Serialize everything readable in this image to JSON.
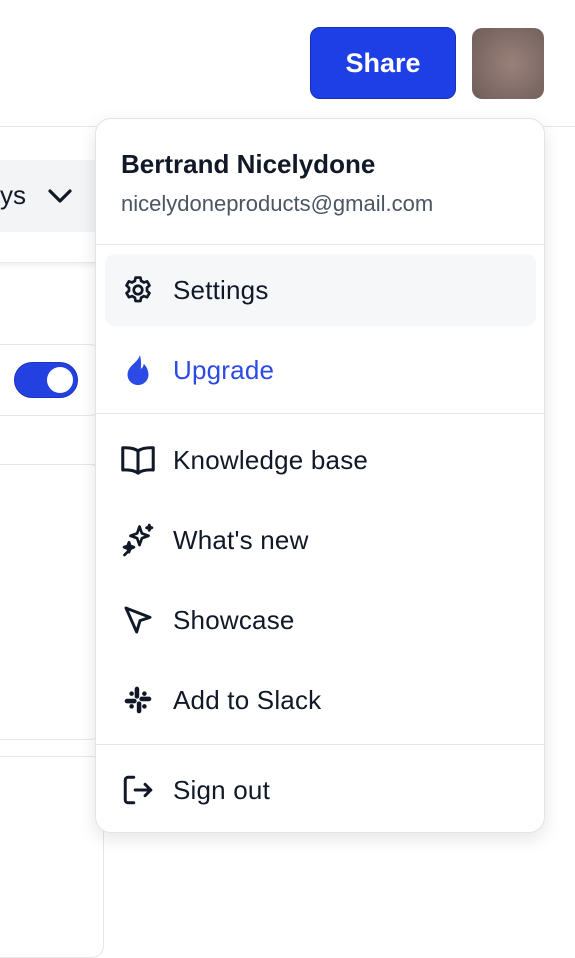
{
  "header": {
    "share_label": "Share",
    "avatar_color": "#86716b"
  },
  "background": {
    "select_text": "ys",
    "toggle_on": true
  },
  "menu": {
    "user_name": "Bertrand Nicelydone",
    "user_email": "nicelydoneproducts@gmail.com",
    "items": [
      {
        "label": "Settings",
        "icon": "gear-icon"
      },
      {
        "label": "Upgrade",
        "icon": "flame-icon"
      },
      {
        "label": "Knowledge base",
        "icon": "book-open-icon"
      },
      {
        "label": "What's new",
        "icon": "sparkles-icon"
      },
      {
        "label": "Showcase",
        "icon": "cursor-arrow-icon"
      },
      {
        "label": "Add to Slack",
        "icon": "slack-icon"
      },
      {
        "label": "Sign out",
        "icon": "sign-out-icon"
      }
    ]
  },
  "colors": {
    "accent": "#1f3fe6",
    "upgrade_text": "#2c4be6",
    "text": "#111827",
    "muted": "#4b5563"
  }
}
